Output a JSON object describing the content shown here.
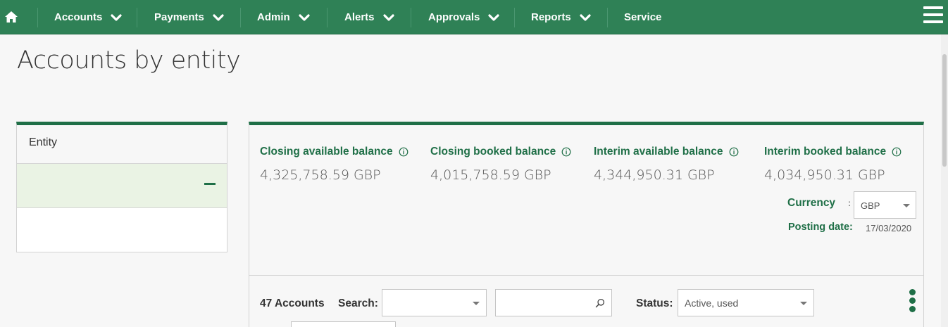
{
  "nav": {
    "home_icon": "home-icon",
    "items": [
      {
        "label": "Accounts"
      },
      {
        "label": "Payments"
      },
      {
        "label": "Admin"
      },
      {
        "label": "Alerts"
      },
      {
        "label": "Approvals"
      },
      {
        "label": "Reports"
      },
      {
        "label": "Service"
      }
    ],
    "menu_icon": "hamburger-menu-icon",
    "background": "#2f8156"
  },
  "page": {
    "title": "Accounts by entity"
  },
  "entity_panel": {
    "header": "Entity",
    "collapse_icon": "minus-icon"
  },
  "balances": [
    {
      "label": "Closing available balance",
      "value": "4,325,758.59 GBP"
    },
    {
      "label": "Closing booked balance",
      "value": "4,015,758.59 GBP"
    },
    {
      "label": "Interim available balance",
      "value": "4,344,950.31 GBP"
    },
    {
      "label": "Interim booked balance",
      "value": "4,034,950.31 GBP"
    }
  ],
  "currency": {
    "label": "Currency",
    "separator": ":",
    "selected": "GBP"
  },
  "posting_date": {
    "label": "Posting date:",
    "value": "17/03/2020"
  },
  "toolbar": {
    "account_count": "47 Accounts",
    "search_label": "Search:",
    "search_select_value": "",
    "search_input_value": "",
    "status_label": "Status:",
    "status_selected": "Active, used"
  },
  "colors": {
    "accent": "#1f6f47",
    "selected_row": "#eaf3e4"
  }
}
